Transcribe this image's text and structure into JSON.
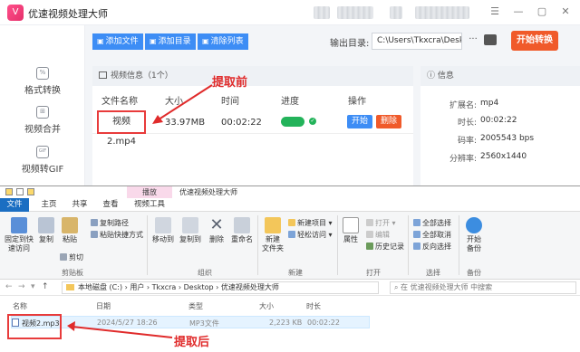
{
  "app": {
    "logo_glyph": "V",
    "title": "优速视频处理大师",
    "window_controls": [
      "☰",
      "—",
      "▢",
      "✕"
    ],
    "sidebar": [
      {
        "icon": "format-convert-icon",
        "glyph": "%",
        "label": "格式转换"
      },
      {
        "icon": "video-merge-icon",
        "glyph": "⊞",
        "label": "视频合并"
      },
      {
        "icon": "gif-icon",
        "glyph": "GIF",
        "label": "视频转GIF"
      }
    ],
    "toolbar": {
      "add_file": "添加文件",
      "add_folder": "添加目录",
      "clear_list": "清除列表",
      "output_label": "输出目录:",
      "output_path": "C:\\Users\\Tkxcra\\Desktop",
      "more": "···",
      "start_convert": "开始转换"
    },
    "video_panel": {
      "header": "视频信息（1个）",
      "columns": [
        "文件名称",
        "大小",
        "时间",
        "进度",
        "操作"
      ],
      "row": {
        "name": "视频2.mp4",
        "size": "33.97MB",
        "time": "00:02:22",
        "progress": 1.0,
        "progress_mark": "✓",
        "start": "开始",
        "delete": "删除"
      }
    },
    "info_panel": {
      "header": "信息",
      "fields": [
        {
          "k": "扩展名:",
          "v": "mp4"
        },
        {
          "k": "时长:",
          "v": "00:02:22"
        },
        {
          "k": "码率:",
          "v": "2005543 bps"
        },
        {
          "k": "分辨率:",
          "v": "2560x1440"
        }
      ]
    },
    "annotation_before": "提取前"
  },
  "explorer": {
    "context_tab": "播放",
    "title": "优速视频处理大师",
    "tabs": [
      "文件",
      "主页",
      "共享",
      "查看",
      "视频工具"
    ],
    "ribbon": {
      "pin": "固定到快\n速访问",
      "copy": "复制",
      "paste": "粘贴",
      "copy_path": "复制路径",
      "paste_shortcut": "粘贴快捷方式",
      "cut": "剪切",
      "clipboard": "剪贴板",
      "move_to": "移动到",
      "copy_to": "复制到",
      "delete": "删除",
      "rename": "重命名",
      "organize": "组织",
      "new_folder": "新建\n文件夹",
      "new_item": "新建项目",
      "easy_access": "轻松访问",
      "new": "新建",
      "properties": "属性",
      "open": "打开",
      "edit": "编辑",
      "history": "历史记录",
      "open_group": "打开",
      "select_all": "全部选择",
      "select_none": "全部取消",
      "invert": "反向选择",
      "select_group": "选择",
      "start_backup": "开始\n备份",
      "backup_group": "备份"
    },
    "address": {
      "path": "本地磁盘 (C:) › 用户 › Tkxcra › Desktop › 优速视频处理大师",
      "search_placeholder": "在 优速视频处理大师 中搜索"
    },
    "columns": [
      "名称",
      "日期",
      "类型",
      "大小",
      "时长"
    ],
    "file": {
      "name": "视频2.mp3",
      "date": "2024/5/27 18:26",
      "type": "MP3文件",
      "size": "2,223 KB",
      "duration": "00:02:22"
    },
    "annotation_after": "提取后"
  },
  "colors": {
    "accent_blue": "#3d8df5",
    "accent_orange": "#f05a2a",
    "annotation_red": "#e02b2b",
    "progress_green": "#23b35a"
  }
}
